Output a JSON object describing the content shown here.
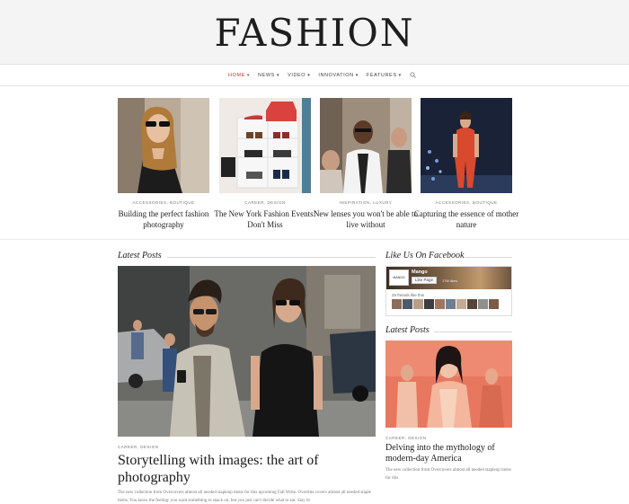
{
  "site": {
    "logo": "FASHION"
  },
  "nav": {
    "items": [
      {
        "label": "HOME"
      },
      {
        "label": "NEWS"
      },
      {
        "label": "VIDEO"
      },
      {
        "label": "INNOVATION"
      },
      {
        "label": "FEATURES"
      }
    ],
    "chevron": "▾",
    "search_icon": "search-icon"
  },
  "featured": [
    {
      "category": "ACCESSORIES, BOUTIQUE",
      "title": "Building the perfect fashion photography"
    },
    {
      "category": "CAREER, DESIGN",
      "title": "The New York Fashion Events! Don't Miss"
    },
    {
      "category": "INSPIRATION, LUXURY",
      "title": "New lenses you won't be able to live without"
    },
    {
      "category": "ACCESSORIES, BOUTIQUE",
      "title": "Capturing the essence of mother nature"
    }
  ],
  "latest": {
    "heading": "Latest Posts",
    "main": {
      "category": "CAREER, DESIGN",
      "title": "Storytelling with images: the art of photography",
      "excerpt": "The new collection from Overcovers almost all needed stapleop items for this upcoming Fall Write. Overritte covers almost all needed staple items. You know the feeling: you want something to snack on, but you just can't decide what to eat. Stay hr"
    }
  },
  "sidebar": {
    "facebook_heading": "Like Us On Facebook",
    "facebook": {
      "page_name": "Mango",
      "page_thumb": "MANGO",
      "like_button": "Like Page",
      "likes": "17M likes",
      "friends_text": "25 friends like this"
    },
    "latest_heading": "Latest Posts",
    "post": {
      "category": "CAREER, DESIGN",
      "title": "Delving into the mythology of modern-day America",
      "excerpt": "The new collection from Overcovers almost all needed stapleop items for this"
    }
  },
  "colors": {
    "accent": "#c0392b",
    "header_bg": "#f4f4f4",
    "text": "#222222"
  }
}
